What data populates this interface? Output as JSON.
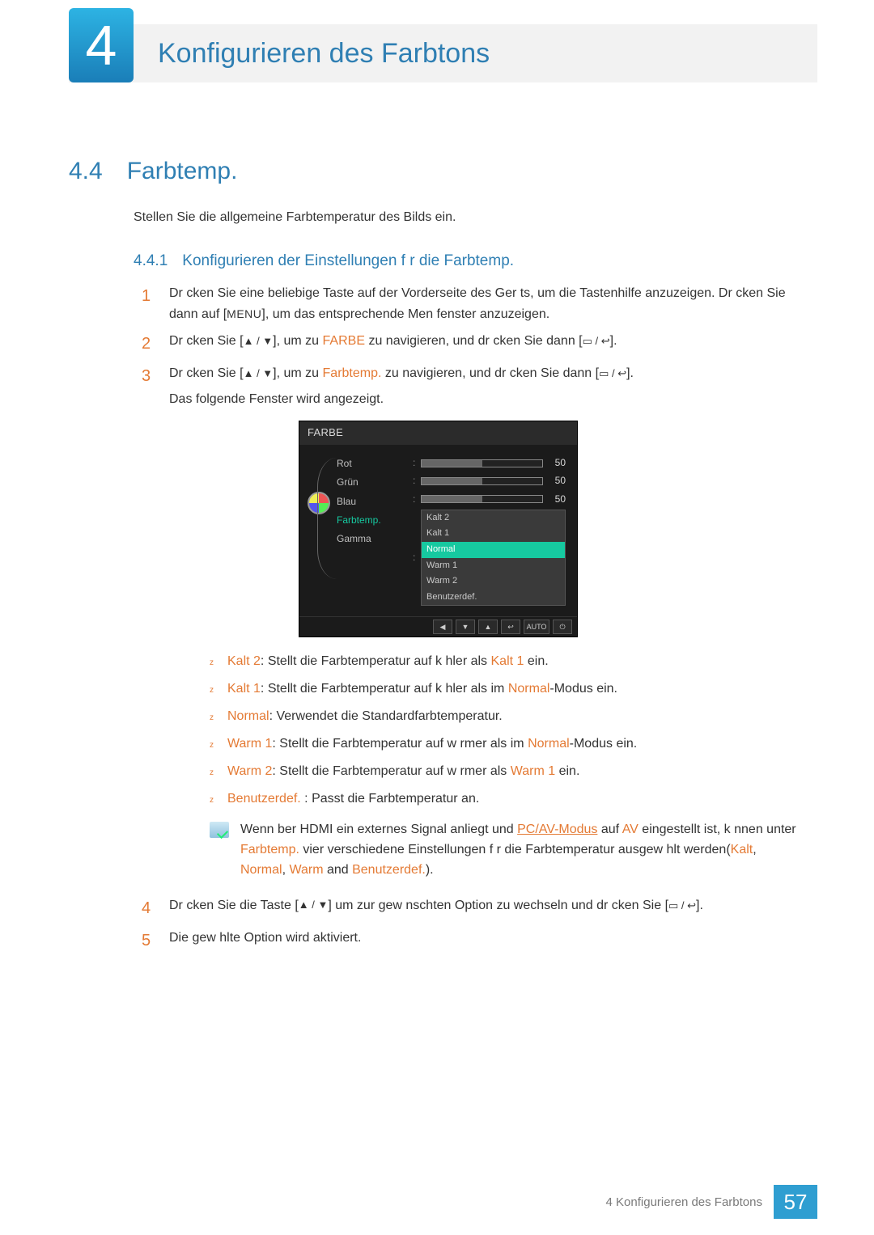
{
  "chapter": {
    "number": "4",
    "title": "Konfigurieren des Farbtons"
  },
  "section": {
    "number": "4.4",
    "title": "Farbtemp.",
    "intro_a": "Stellen Sie die allgemeine",
    "intro_b": "Farbtemperatur des Bilds ein."
  },
  "subsection": {
    "number": "4.4.1",
    "title": "Konfigurieren der Einstellungen f r die Farbtemp."
  },
  "steps": {
    "s1": {
      "num": "1",
      "a": "Dr cken Sie eine beliebige Taste auf der Vorderseite des Ger ts, um die Tastenhilfe anzuzeigen. Dr cken Sie dann auf [",
      "menu": "MENU",
      "b": "], um das entsprechende Men fenster anzuzeigen."
    },
    "s2": {
      "num": "2",
      "a": "Dr cken Sie [",
      "arrows": "▲ / ▼",
      "b": "], um zu ",
      "hl": "FARBE",
      "c": " zu navigieren, und dr cken Sie dann [",
      "d": "]."
    },
    "s3": {
      "num": "3",
      "a": "Dr cken Sie [",
      "arrows": "▲ / ▼",
      "b": "], um zu ",
      "hl": "Farbtemp.",
      "c": " zu navigieren, und dr cken Sie dann [",
      "d": "].",
      "e": "Das folgende Fenster wird angezeigt."
    },
    "s4": {
      "num": "4",
      "a": "Dr cken Sie die Taste [",
      "arrows": "▲ / ▼",
      "b": "] um zur gew nschten Option zu wechseln und dr cken Sie [",
      "c": "]."
    },
    "s5": {
      "num": "5",
      "a": "Die gew hlte Option wird aktiviert."
    }
  },
  "osd": {
    "title": "FARBE",
    "items": {
      "rot": "Rot",
      "gruen": "Grün",
      "blau": "Blau",
      "farbtemp": "Farbtemp.",
      "gamma": "Gamma"
    },
    "values": {
      "rot": "50",
      "gruen": "50",
      "blau": "50"
    },
    "dropdown": {
      "kalt2": "Kalt 2",
      "kalt1": "Kalt 1",
      "normal": "Normal",
      "warm1": "Warm 1",
      "warm2": "Warm 2",
      "benutzer": "Benutzerdef."
    },
    "footer": {
      "b1": "◀",
      "b2": "▼",
      "b3": "▲",
      "b4": "↩",
      "auto": "AUTO",
      "pwr": "⏻"
    }
  },
  "bullets": {
    "b1": {
      "hl": "Kalt 2",
      "a": ": Stellt die Farbtemperatur auf k hler als",
      "hl2": "Kalt 1",
      "b": " ein."
    },
    "b2": {
      "hl": "Kalt 1",
      "a": ": Stellt die Farbtemperatur auf k hler als im",
      "hl2": "Normal",
      "b": "-Modus ein."
    },
    "b3": {
      "hl": "Normal",
      "a": ": Verwendet die Standardfarbtemperatur."
    },
    "b4": {
      "hl": "Warm 1",
      "a": ": Stellt die Farbtemperatur auf w rmer als im",
      "hl2": "Normal",
      "b": "-Modus ein."
    },
    "b5": {
      "hl": "Warm 2",
      "a": ": Stellt die Farbtemperatur auf w rmer als",
      "hl2": "Warm 1",
      "b": " ein."
    },
    "b6": {
      "hl": "Benutzerdef.",
      "a": " : Passt die Farbtemperatur an."
    }
  },
  "note": {
    "a": "Wenn  ber HDMI ein externes Signal anliegt und",
    "hl1": "PC/AV-Modus",
    "b": " auf ",
    "hl2": "AV",
    "c": " eingestellt ist, k nnen unter ",
    "hl3": "Farbtemp.",
    "d": " vier verschiedene Einstellungen f r die Farbtemperatur ausgew hlt werden(",
    "hl4": "Kalt",
    "e": ", ",
    "hl5": "Normal",
    "f": ", ",
    "hl6": "Warm",
    "g": " and ",
    "hl7": "Benutzerdef.",
    "h": ")."
  },
  "footer": {
    "label": "4 Konfigurieren des Farbtons",
    "page": "57"
  }
}
